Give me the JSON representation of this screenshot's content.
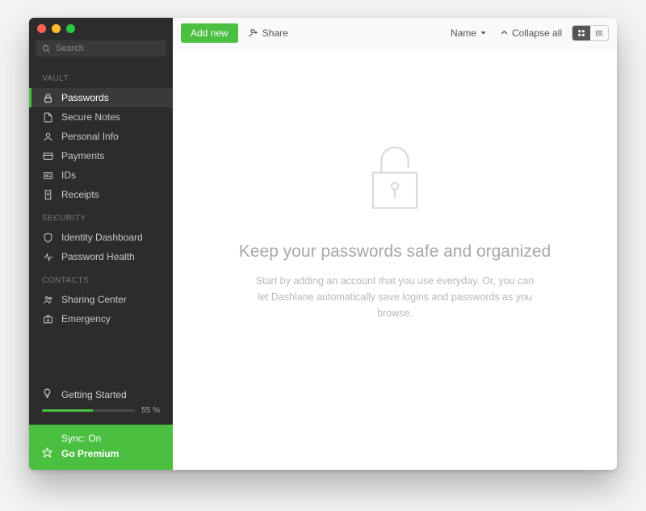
{
  "search": {
    "placeholder": "Search"
  },
  "sidebar": {
    "vault_header": "VAULT",
    "security_header": "SECURITY",
    "contacts_header": "CONTACTS",
    "vault_items": [
      {
        "label": "Passwords",
        "active": true
      },
      {
        "label": "Secure Notes"
      },
      {
        "label": "Personal Info"
      },
      {
        "label": "Payments"
      },
      {
        "label": "IDs"
      },
      {
        "label": "Receipts"
      }
    ],
    "security_items": [
      {
        "label": "Identity Dashboard"
      },
      {
        "label": "Password Health"
      }
    ],
    "contacts_items": [
      {
        "label": "Sharing Center"
      },
      {
        "label": "Emergency"
      }
    ]
  },
  "getting_started": {
    "label": "Getting Started",
    "percent_text": "55 %",
    "percent_value": 55
  },
  "bottom": {
    "sync_label": "Sync: On",
    "premium_label": "Go Premium"
  },
  "toolbar": {
    "add_new": "Add new",
    "share": "Share",
    "sort_label": "Name",
    "collapse_label": "Collapse all"
  },
  "empty": {
    "title": "Keep your passwords safe and organized",
    "subtitle": "Start by adding an account that you use everyday. Or, you can let Dashlane automatically save logins and passwords as you browse."
  },
  "colors": {
    "accent": "#4abf40",
    "sidebar_bg": "#2c2c2c"
  }
}
